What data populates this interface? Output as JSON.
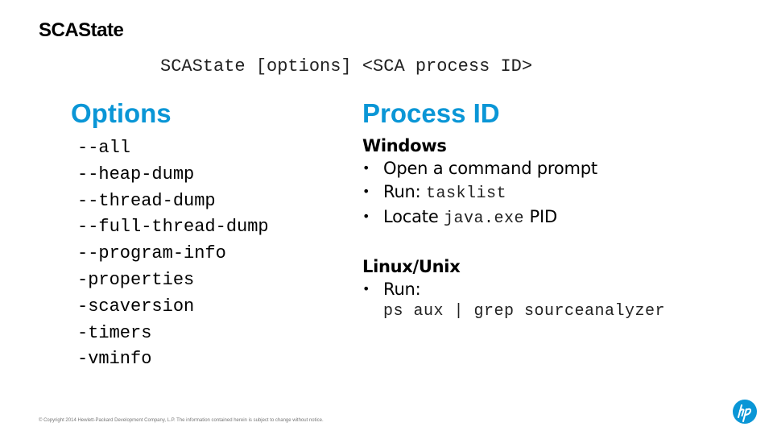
{
  "slide": {
    "title": "SCAState",
    "syntax": "SCAState [options] <SCA process ID>",
    "options": {
      "heading": "Options",
      "items": [
        "--all",
        "--heap-dump",
        "--thread-dump",
        "--full-thread-dump",
        "--program-info",
        "-properties",
        "-scaversion",
        "-timers",
        "-vminfo"
      ]
    },
    "process_id": {
      "heading": "Process ID",
      "windows": {
        "heading": "Windows",
        "bullet_1": "Open a command prompt",
        "bullet_2_prefix": "Run: ",
        "bullet_2_code": "tasklist",
        "bullet_3_prefix": "Locate ",
        "bullet_3_code": "java.exe",
        "bullet_3_suffix": " PID"
      },
      "linux": {
        "heading": "Linux/Unix",
        "bullet_1": "Run:",
        "command": "ps aux | grep sourceanalyzer"
      }
    },
    "bullet_glyph": "•",
    "footer": "© Copyright 2014 Hewlett-Packard Development Company, L.P.  The information contained herein is subject to change without notice.",
    "logo_icon": "hp-logo-icon",
    "accent_color": "#0a96d6"
  }
}
